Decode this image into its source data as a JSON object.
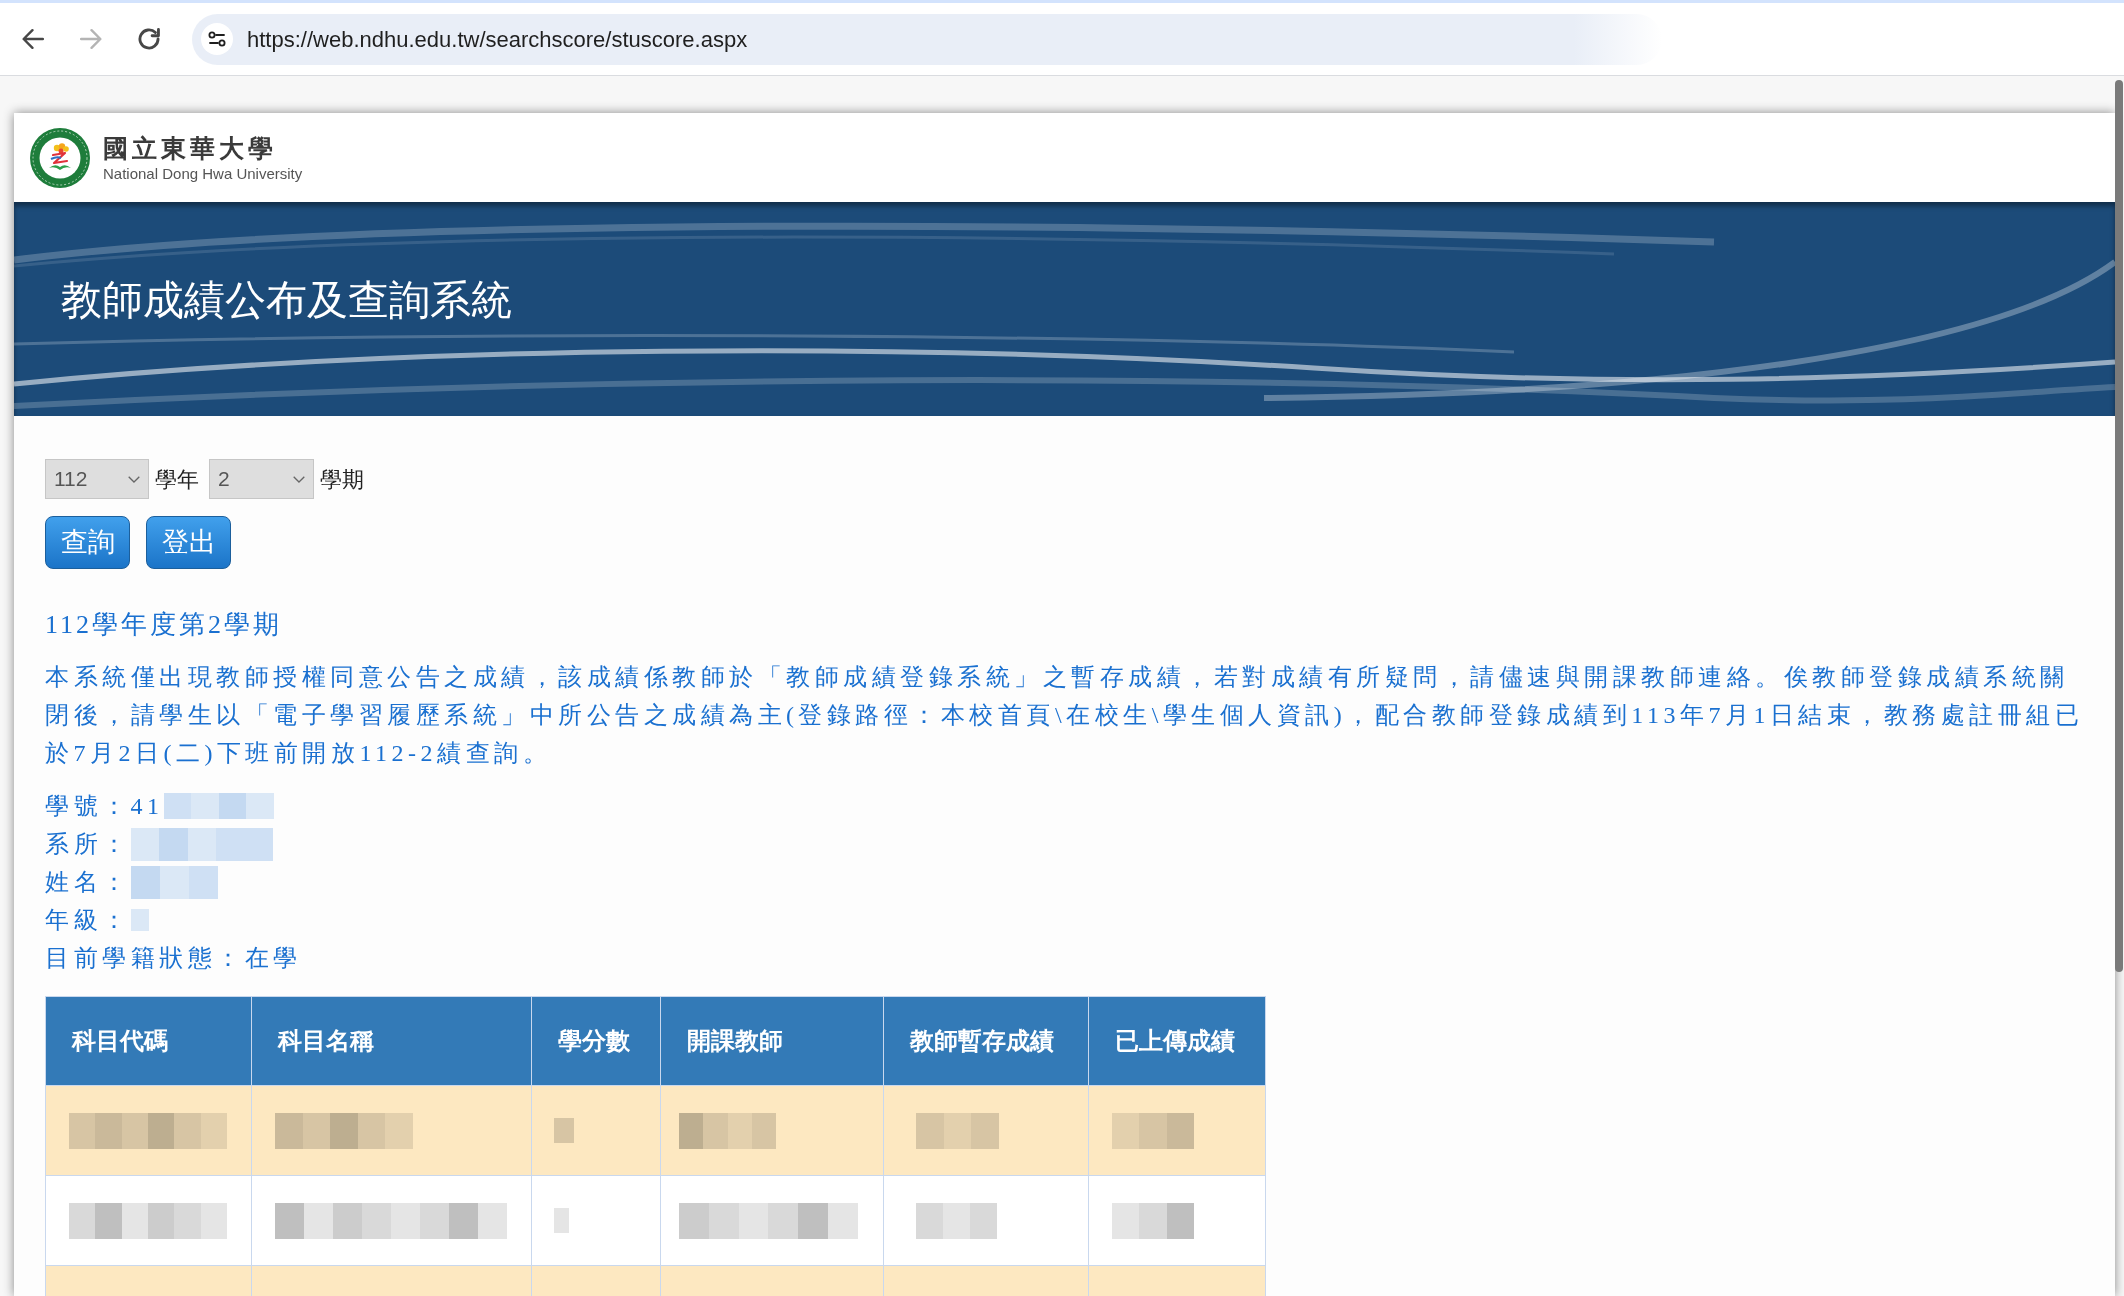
{
  "browser": {
    "nav_buttons": [
      {
        "kind": "back",
        "disabled": false
      },
      {
        "kind": "forward",
        "disabled": true
      },
      {
        "kind": "reload",
        "disabled": false
      }
    ],
    "url": "https://web.ndhu.edu.tw/searchscore/stuscore.aspx"
  },
  "logo": {
    "chinese_name": "國立東華大學",
    "english_name": "National Dong Hwa University"
  },
  "banner_title": "教師成績公布及查詢系統",
  "query_form": {
    "selects": [
      {
        "value": "112",
        "suffix": "學年"
      },
      {
        "value": "2",
        "suffix": "學期"
      }
    ],
    "buttons": [
      "查詢",
      "登出"
    ]
  },
  "term_heading": "112學年度第2學期",
  "notice": "本系統僅出現教師授權同意公告之成績，該成績係教師於「教師成績登錄系統」之暫存成績，若對成績有所疑問，請儘速與開課教師連絡。俟教師登錄成績系統關閉後，請學生以「電子學習履歷系統」中所公告之成績為主(登錄路徑：本校首頁\\在校生\\學生個人資訊)，配合教師登錄成績到113年7月1日結束，教務處註冊組已於7月2日(二)下班前開放112-2績查詢。",
  "student_info": [
    {
      "label": "學號：",
      "value": "41",
      "redacted": true
    },
    {
      "label": "系所：",
      "redacted": true
    },
    {
      "label": "姓名：",
      "redacted": true
    },
    {
      "label": "年級：",
      "redacted": true
    },
    {
      "label": "目前學籍狀態：",
      "value": "在學",
      "redacted": false
    }
  ],
  "table": {
    "columns": [
      "科目代碼",
      "科目名稱",
      "學分數",
      "開課教師",
      "教師暫存成績",
      "已上傳成績"
    ],
    "rows": [
      {
        "cells": [
          {
            "redacted": true
          },
          {
            "redacted": true
          },
          {
            "redacted": true
          },
          {
            "redacted": true
          },
          {
            "redacted": true
          },
          {
            "redacted": true
          }
        ]
      },
      {
        "cells": [
          {
            "redacted": true
          },
          {
            "redacted": true
          },
          {
            "redacted": true
          },
          {
            "redacted": true
          },
          {
            "redacted": true
          },
          {
            "redacted": true
          }
        ]
      },
      {
        "cells": [
          {
            "redacted": false
          },
          {
            "redacted": false
          },
          {
            "redacted": false
          },
          {
            "redacted": false
          },
          {
            "redacted": false
          },
          {
            "redacted": false
          }
        ]
      }
    ]
  }
}
